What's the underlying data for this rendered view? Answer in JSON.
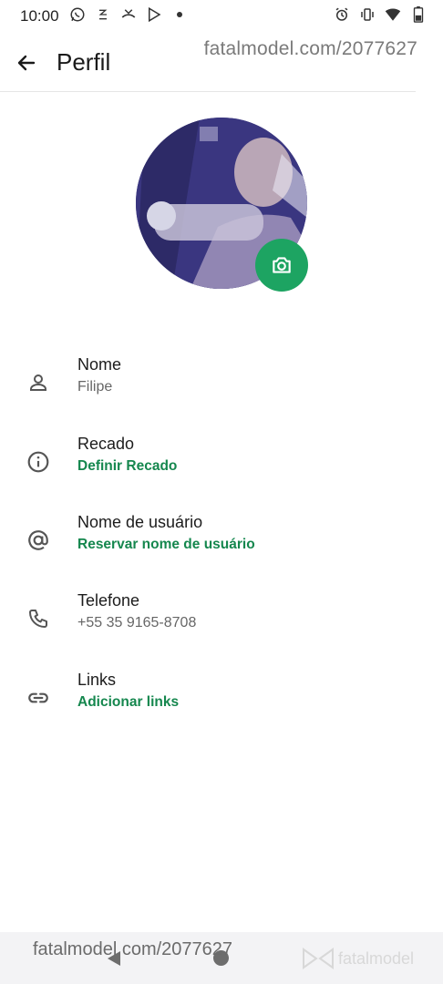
{
  "status_bar": {
    "time": "10:00",
    "left_icons": [
      "whatsapp-icon",
      "notification-icon",
      "missed-call-icon",
      "play-store-icon",
      "dot-icon"
    ],
    "right_icons": [
      "alarm-icon",
      "vibrate-icon",
      "wifi-icon",
      "battery-icon"
    ]
  },
  "watermark": {
    "top_text": "fatalmodel.com/2077627",
    "bottom_text": "fatalmodel.com/2077627",
    "logo_text": "fatalmodel"
  },
  "header": {
    "title": "Perfil"
  },
  "profile": {
    "fields": [
      {
        "icon": "person-icon",
        "title": "Nome",
        "value": "Filipe",
        "action": false
      },
      {
        "icon": "info-icon",
        "title": "Recado",
        "value": "Definir Recado",
        "action": true
      },
      {
        "icon": "at-icon",
        "title": "Nome de usuário",
        "value": "Reservar nome de usuário",
        "action": true
      },
      {
        "icon": "phone-icon",
        "title": "Telefone",
        "value": "+55 35 9165-8708",
        "action": false
      },
      {
        "icon": "link-icon",
        "title": "Links",
        "value": "Adicionar links",
        "action": true
      }
    ]
  },
  "colors": {
    "accent": "#1da462",
    "action_text": "#15874e",
    "text": "#1c1c1c",
    "secondary_text": "#666666"
  }
}
